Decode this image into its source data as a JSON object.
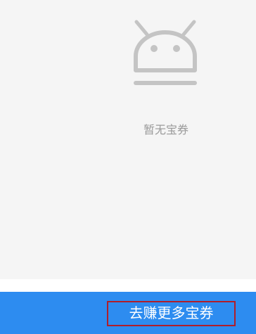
{
  "empty_state": {
    "icon": "android-robot-icon",
    "message": "暂无宝券"
  },
  "footer": {
    "earn_more_label": "去赚更多宝券",
    "button_color": "#2d8cf0",
    "highlight_border_color": "#b01e2a"
  }
}
